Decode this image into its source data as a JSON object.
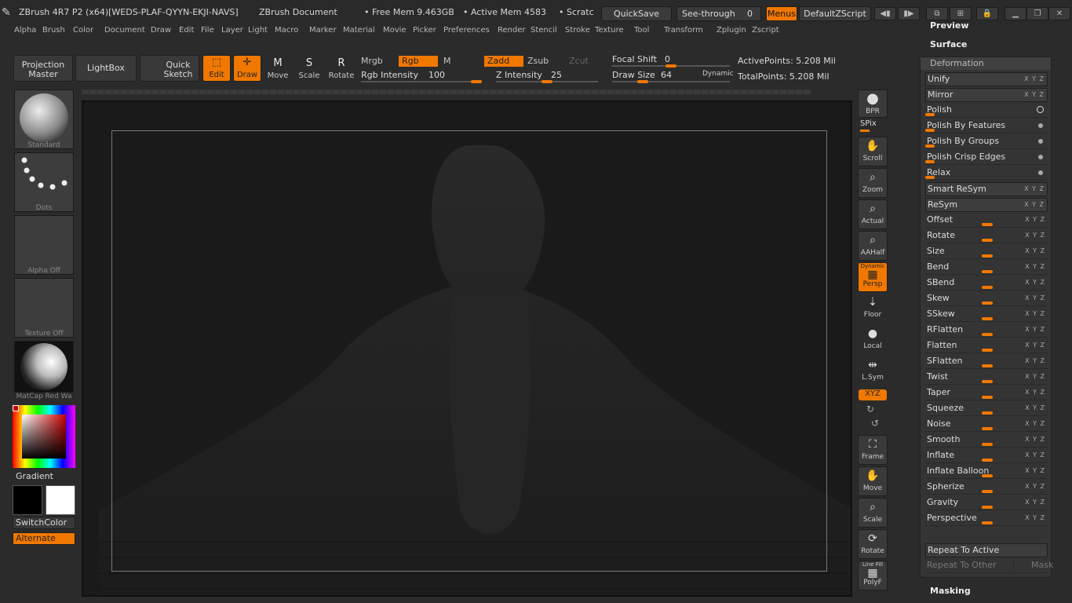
{
  "titlebar": {
    "app_title": "ZBrush 4R7 P2 (x64)[WEDS-PLAF-QYYN-EKJI-NAVS]",
    "doc_title": "ZBrush Document",
    "free_mem": "• Free Mem 9.463GB",
    "active_mem": "• Active Mem 4583",
    "scratch": "• Scratc",
    "quicksave": "QuickSave",
    "see_through": "See-through",
    "see_through_value": "0",
    "menus": "Menus",
    "default_zscript": "DefaultZScript"
  },
  "menubar": [
    "Alpha",
    "Brush",
    "Color",
    "Document",
    "Draw",
    "Edit",
    "File",
    "Layer",
    "Light",
    "Macro",
    "Marker",
    "Material",
    "Movie",
    "Picker",
    "Preferences",
    "Render",
    "Stencil",
    "Stroke",
    "Texture",
    "Tool",
    "Transform",
    "Zplugin",
    "Zscript"
  ],
  "shelf": {
    "projection_master": "Projection Master",
    "lightbox": "LightBox",
    "quick_sketch": "Quick Sketch",
    "edit": "Edit",
    "draw": "Draw",
    "move": "Move",
    "scale": "Scale",
    "rotate": "Rotate",
    "mrgb": "Mrgb",
    "rgb": "Rgb",
    "m": "M",
    "zadd": "Zadd",
    "zsub": "Zsub",
    "zcut": "Zcut",
    "rgb_intensity_label": "Rgb Intensity",
    "rgb_intensity_value": "100",
    "z_intensity_label": "Z Intensity",
    "z_intensity_value": "25",
    "focal_shift_label": "Focal Shift",
    "focal_shift_value": "0",
    "draw_size_label": "Draw Size",
    "draw_size_value": "64",
    "dynamic": "Dynamic",
    "active_points": "ActivePoints: 5.208 Mil",
    "total_points": "TotalPoints: 5.208 Mil"
  },
  "left": {
    "brush": "Standard",
    "stroke": "Dots",
    "alpha": "Alpha Off",
    "texture": "Texture Off",
    "material": "MatCap Red Wa",
    "gradient": "Gradient",
    "switchcolor": "SwitchColor",
    "alternate": "Alternate"
  },
  "rightshelf": {
    "bpr": "BPR",
    "spix": "SPix",
    "scroll": "Scroll",
    "zoom": "Zoom",
    "actual": "Actual",
    "aahalf": "AAHalf",
    "persp": "Persp",
    "persp_top": "Dynamic",
    "floor": "Floor",
    "local": "Local",
    "lsym": "L.Sym",
    "xyz": "XYZ",
    "frame": "Frame",
    "move": "Move",
    "scale": "Scale",
    "rotate": "Rotate",
    "polyf": "PolyF",
    "linefill": "Line Fill"
  },
  "rightpanel": {
    "preview": "Preview",
    "surface": "Surface",
    "deformation": "Deformation",
    "masking": "Masking",
    "rows": [
      {
        "label": "Unify",
        "style": "boxed"
      },
      {
        "label": "Mirror",
        "style": "boxed"
      },
      {
        "label": "Polish",
        "style": "ring"
      },
      {
        "label": "Polish By Features",
        "style": "dot"
      },
      {
        "label": "Polish By Groups",
        "style": "dot"
      },
      {
        "label": "Polish Crisp Edges",
        "style": "dot"
      },
      {
        "label": "Relax",
        "style": "dot"
      },
      {
        "label": "Smart ReSym",
        "style": "boxed"
      },
      {
        "label": "ReSym",
        "style": "boxed"
      },
      {
        "label": "Offset",
        "style": "slider"
      },
      {
        "label": "Rotate",
        "style": "slider"
      },
      {
        "label": "Size",
        "style": "slider"
      },
      {
        "label": "Bend",
        "style": "slider"
      },
      {
        "label": "SBend",
        "style": "slider"
      },
      {
        "label": "Skew",
        "style": "slider"
      },
      {
        "label": "SSkew",
        "style": "slider"
      },
      {
        "label": "RFlatten",
        "style": "slider"
      },
      {
        "label": "Flatten",
        "style": "slider"
      },
      {
        "label": "SFlatten",
        "style": "slider"
      },
      {
        "label": "Twist",
        "style": "slider"
      },
      {
        "label": "Taper",
        "style": "slider"
      },
      {
        "label": "Squeeze",
        "style": "slider"
      },
      {
        "label": "Noise",
        "style": "slider"
      },
      {
        "label": "Smooth",
        "style": "slider"
      },
      {
        "label": "Inflate",
        "style": "slider"
      },
      {
        "label": "Inflate Balloon",
        "style": "slider"
      },
      {
        "label": "Spherize",
        "style": "slider"
      },
      {
        "label": "Gravity",
        "style": "slider"
      },
      {
        "label": "Perspective",
        "style": "slider"
      }
    ],
    "xyz": "X Y Z",
    "repeat_active": "Repeat To Active",
    "repeat_other": "Repeat To Other",
    "mask": "Mask"
  },
  "colors": {
    "accent": "#f07800",
    "panel": "#343434",
    "canvas": "#1a1a1a"
  }
}
